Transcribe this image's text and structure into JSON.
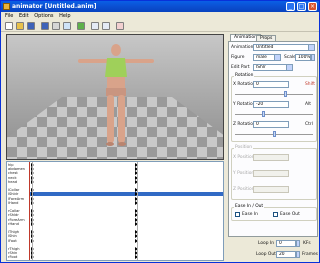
{
  "window": {
    "title": "animator [Untitled.anim]",
    "minimize_glyph": "_",
    "maximize_glyph": "□",
    "close_glyph": "×"
  },
  "menu": [
    "File",
    "Edit",
    "Options",
    "Help"
  ],
  "toolbar": {
    "icons": [
      "new-file-icon",
      "open-folder-icon",
      "save-icon",
      "save-all-icon",
      "print-icon",
      "preview-icon",
      "play-icon",
      "undo-icon",
      "redo-icon",
      "delete-icon"
    ]
  },
  "timeline": {
    "tracks": [
      "hip",
      "abdomen",
      "chest",
      "neck",
      "head",
      "",
      "lCollar",
      "lShldr",
      "lForeArm",
      "lHand",
      "",
      "rCollar",
      "rShldr",
      "rForeArm",
      "rHand",
      "",
      "lThigh",
      "lShin",
      "lFoot",
      "",
      "rThigh",
      "rShin",
      "rFoot"
    ],
    "selected_track_index": 7
  },
  "panel": {
    "tabs": [
      "Animation",
      "Props"
    ],
    "animation_label": "Animation",
    "animation_value": "Untitled",
    "figure_label": "Figure",
    "figure_value": "male",
    "scale_label": "Scale",
    "scale_value": "100%",
    "edit_part_label": "Edit Part",
    "edit_part_value": "lShlr",
    "rotation_group": "Rotation",
    "x_rotation_label": "X Rotation",
    "x_rotation_value": "0",
    "x_shift_label": "Shift",
    "y_rotation_label": "Y Rotation",
    "y_rotation_value": "-20",
    "y_shift_label": "Alt",
    "z_rotation_label": "Z Rotation",
    "z_rotation_value": "0",
    "z_shift_label": "Ctrl",
    "position_group": "Position",
    "x_position_label": "X Position",
    "y_position_label": "Y Position",
    "z_position_label": "Z Position",
    "ease_group": "Ease In / Out",
    "ease_in_label": "Ease In",
    "ease_out_label": "Ease Out",
    "loop_in_label": "Loop In",
    "loop_in_value": "0",
    "loop_in_unit": "KFs",
    "loop_out_label": "Loop Out",
    "loop_out_value": "20",
    "loop_out_unit": "Frames"
  },
  "colors": {
    "titlebar": "#0a5fe6",
    "figure_shirt": "#9fd05a",
    "selected_row": "#316ac5"
  }
}
